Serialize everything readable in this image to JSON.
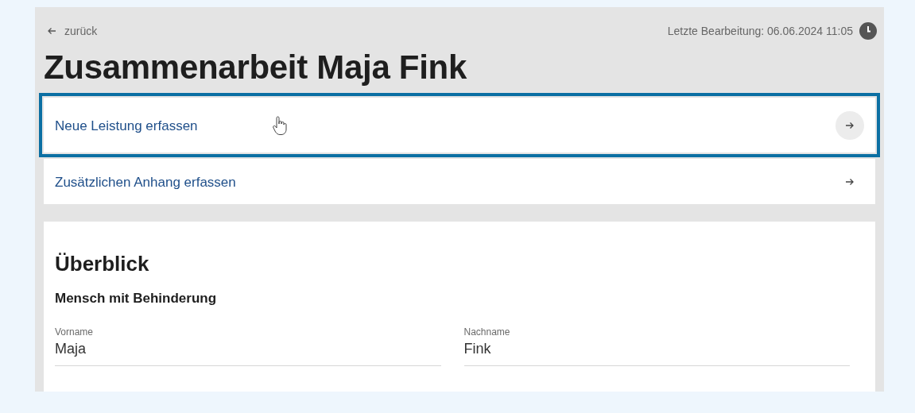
{
  "back_link": {
    "label": "zurück"
  },
  "last_edit": {
    "text": "Letzte Bearbeitung: 06.06.2024 11:05"
  },
  "title": "Zusammenarbeit Maja Fink",
  "actions": [
    {
      "label": "Neue Leistung erfassen",
      "focused": true
    },
    {
      "label": "Zusätzlichen Anhang erfassen",
      "focused": false
    }
  ],
  "overview": {
    "title": "Überblick",
    "section": "Mensch mit Behinderung",
    "fields": [
      {
        "label": "Vorname",
        "value": "Maja"
      },
      {
        "label": "Nachname",
        "value": "Fink"
      }
    ]
  }
}
